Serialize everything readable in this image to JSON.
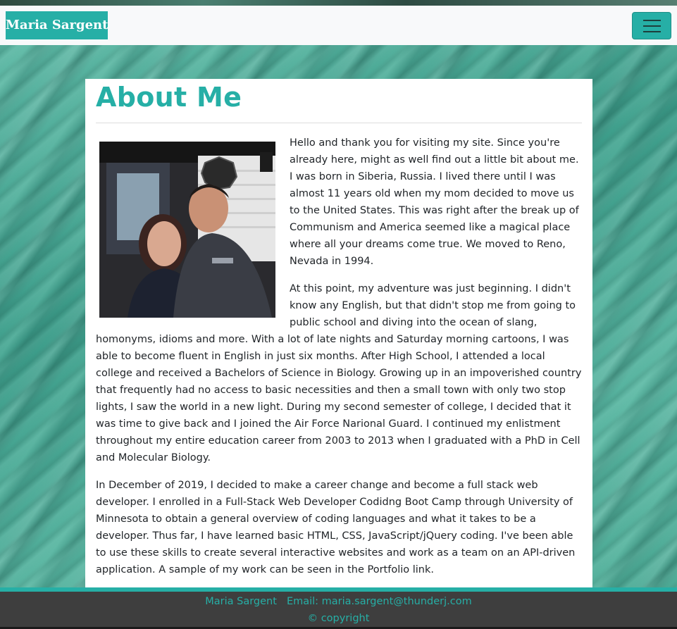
{
  "navbar": {
    "brand": "Maria Sargent",
    "menu_icon": "hamburger-menu-icon"
  },
  "about": {
    "heading": "About Me",
    "photo_icon": "profile-photo",
    "paragraphs": [
      "Hello and thank you for visiting my site. Since you're already here, might as well find out a little bit about me. I was born in Siberia, Russia. I lived there until I was almost 11 years old when my mom decided to move us to the United States. This was right after the break up of Communism and America seemed like a magical place where all your dreams come true. We moved to Reno, Nevada in 1994.",
      "At this point, my adventure was just beginning. I didn't know any English, but that didn't stop me from going to public school and diving into the ocean of slang, homonyms, idioms and more. With a lot of late nights and Saturday morning cartoons, I was able to become fluent in English in just six months. After High School, I attended a local college and received a Bachelors of Science in Biology. Growing up in an impoverished country that frequently had no access to basic necessities and then a small town with only two stop lights, I saw the world in a new light. During my second semester of college, I decided that it was time to give back and I joined the Air Force Narional Guard. I continued my enlistment throughout my entire education career from 2003 to 2013 when I graduated with a PhD in Cell and Molecular Biology.",
      "In December of 2019, I decided to make a career change and become a full stack web developer. I enrolled in a Full-Stack Web Developer Codidng Boot Camp through University of Minnesota to obtain a general overview of coding languages and what it takes to be a developer. Thus far, I have learned basic HTML, CSS, JavaScript/jQuery coding. I've been able to use these skills to create several interactive websites and work as a team on an API-driven application. A sample of my work can be seen in the Portfolio link."
    ]
  },
  "footer": {
    "name": "Maria Sargent",
    "email": "Email: maria.sargent@thunderj.com",
    "copyright": "© copyright"
  },
  "colors": {
    "accent": "#26afa6",
    "footer_bg": "#3e3e3e",
    "navbar_bg": "#f8f9fa"
  }
}
